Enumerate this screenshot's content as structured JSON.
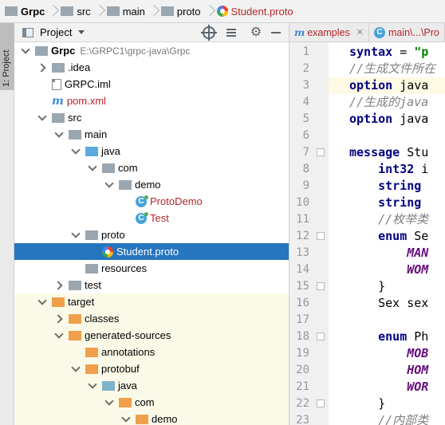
{
  "breadcrumb": [
    {
      "label": "Grpc",
      "icon": "folder",
      "color": "grey",
      "bold": true
    },
    {
      "label": "src",
      "icon": "folder",
      "color": "grey"
    },
    {
      "label": "main",
      "icon": "folder",
      "color": "grey"
    },
    {
      "label": "proto",
      "icon": "folder",
      "color": "grey"
    },
    {
      "label": "Student.proto",
      "icon": "proto",
      "red": true
    }
  ],
  "side_strip": {
    "label": "1: Project"
  },
  "project_panel": {
    "title": "Project"
  },
  "tree": [
    {
      "label": "Grpc",
      "path": "E:\\GRPC1\\grpc-java\\Grpc",
      "depth": 0,
      "arrow": "open",
      "icon": "folder-grey",
      "bold": true
    },
    {
      "label": ".idea",
      "depth": 1,
      "arrow": "closed",
      "icon": "folder-grey"
    },
    {
      "label": "GRPC.iml",
      "depth": 1,
      "arrow": "none",
      "icon": "iml"
    },
    {
      "label": "pom.xml",
      "depth": 1,
      "arrow": "none",
      "icon": "maven",
      "red": true
    },
    {
      "label": "src",
      "depth": 1,
      "arrow": "open",
      "icon": "folder-grey"
    },
    {
      "label": "main",
      "depth": 2,
      "arrow": "open",
      "icon": "folder-grey"
    },
    {
      "label": "java",
      "depth": 3,
      "arrow": "open",
      "icon": "folder-blue"
    },
    {
      "label": "com",
      "depth": 4,
      "arrow": "open",
      "icon": "folder-grey"
    },
    {
      "label": "demo",
      "depth": 5,
      "arrow": "open",
      "icon": "folder-grey"
    },
    {
      "label": "ProtoDemo",
      "depth": 6,
      "arrow": "none",
      "icon": "class",
      "red": true
    },
    {
      "label": "Test",
      "depth": 6,
      "arrow": "none",
      "icon": "class",
      "red": true
    },
    {
      "label": "proto",
      "depth": 3,
      "arrow": "open",
      "icon": "folder-grey"
    },
    {
      "label": "Student.proto",
      "depth": 4,
      "arrow": "none",
      "icon": "proto",
      "selected": true
    },
    {
      "label": "resources",
      "depth": 3,
      "arrow": "none",
      "icon": "folder-resources"
    },
    {
      "label": "test",
      "depth": 2,
      "arrow": "closed",
      "icon": "folder-grey"
    },
    {
      "label": "target",
      "depth": 1,
      "arrow": "open",
      "icon": "folder-orange",
      "highlight": true
    },
    {
      "label": "classes",
      "depth": 2,
      "arrow": "closed",
      "icon": "folder-orange",
      "highlight": true
    },
    {
      "label": "generated-sources",
      "depth": 2,
      "arrow": "open",
      "icon": "folder-orange",
      "highlight": true
    },
    {
      "label": "annotations",
      "depth": 3,
      "arrow": "none",
      "icon": "folder-orange",
      "highlight": true
    },
    {
      "label": "protobuf",
      "depth": 3,
      "arrow": "open",
      "icon": "folder-orange",
      "highlight": true
    },
    {
      "label": "java",
      "depth": 4,
      "arrow": "open",
      "icon": "folder-teal",
      "highlight": true
    },
    {
      "label": "com",
      "depth": 5,
      "arrow": "open",
      "icon": "folder-orange",
      "highlight": true
    },
    {
      "label": "demo",
      "depth": 6,
      "arrow": "open",
      "icon": "folder-orange",
      "highlight": true
    }
  ],
  "tabs": [
    {
      "label": "examples",
      "icon": "maven",
      "close": "✕"
    },
    {
      "label": "main\\...\\Pro",
      "icon": "class"
    }
  ],
  "editor": {
    "current_line": 3,
    "lines": [
      {
        "n": "1",
        "parts": [
          {
            "t": "syntax",
            "c": "kw"
          },
          {
            "t": " = ",
            "c": ""
          },
          {
            "t": "\"p",
            "c": "str"
          }
        ]
      },
      {
        "n": "2",
        "parts": [
          {
            "t": "//生成文件所在",
            "c": "cm"
          }
        ]
      },
      {
        "n": "3",
        "parts": [
          {
            "t": "option",
            "c": "kw"
          },
          {
            "t": " java",
            "c": ""
          }
        ]
      },
      {
        "n": "4",
        "parts": [
          {
            "t": "//生成的java",
            "c": "cm"
          }
        ]
      },
      {
        "n": "5",
        "parts": [
          {
            "t": "option",
            "c": "kw"
          },
          {
            "t": " java",
            "c": ""
          }
        ]
      },
      {
        "n": "6",
        "parts": []
      },
      {
        "n": "7",
        "parts": [
          {
            "t": "message",
            "c": "kw"
          },
          {
            "t": " Stu",
            "c": ""
          }
        ]
      },
      {
        "n": "8",
        "parts": [
          {
            "t": "    ",
            "c": ""
          },
          {
            "t": "int32",
            "c": "kw"
          },
          {
            "t": " i",
            "c": ""
          }
        ]
      },
      {
        "n": "9",
        "parts": [
          {
            "t": "    ",
            "c": ""
          },
          {
            "t": "string",
            "c": "kw"
          }
        ]
      },
      {
        "n": "10",
        "parts": [
          {
            "t": "    ",
            "c": ""
          },
          {
            "t": "string",
            "c": "kw"
          }
        ]
      },
      {
        "n": "11",
        "parts": [
          {
            "t": "    ",
            "c": ""
          },
          {
            "t": "//枚举类",
            "c": "cm"
          }
        ]
      },
      {
        "n": "12",
        "parts": [
          {
            "t": "    ",
            "c": ""
          },
          {
            "t": "enum",
            "c": "kw"
          },
          {
            "t": " Se",
            "c": ""
          }
        ]
      },
      {
        "n": "13",
        "parts": [
          {
            "t": "        ",
            "c": ""
          },
          {
            "t": "MAN",
            "c": "en"
          }
        ]
      },
      {
        "n": "14",
        "parts": [
          {
            "t": "        ",
            "c": ""
          },
          {
            "t": "WOM",
            "c": "en"
          }
        ]
      },
      {
        "n": "15",
        "parts": [
          {
            "t": "    }",
            "c": ""
          }
        ]
      },
      {
        "n": "16",
        "parts": [
          {
            "t": "    Sex sex",
            "c": ""
          }
        ]
      },
      {
        "n": "17",
        "parts": []
      },
      {
        "n": "18",
        "parts": [
          {
            "t": "    ",
            "c": ""
          },
          {
            "t": "enum",
            "c": "kw"
          },
          {
            "t": " Ph",
            "c": ""
          }
        ]
      },
      {
        "n": "19",
        "parts": [
          {
            "t": "        ",
            "c": ""
          },
          {
            "t": "MOB",
            "c": "en"
          }
        ]
      },
      {
        "n": "20",
        "parts": [
          {
            "t": "        ",
            "c": ""
          },
          {
            "t": "HOM",
            "c": "en"
          }
        ]
      },
      {
        "n": "21",
        "parts": [
          {
            "t": "        ",
            "c": ""
          },
          {
            "t": "WOR",
            "c": "en"
          }
        ]
      },
      {
        "n": "22",
        "parts": [
          {
            "t": "    }",
            "c": ""
          }
        ]
      },
      {
        "n": "23",
        "parts": [
          {
            "t": "    ",
            "c": ""
          },
          {
            "t": "//内部类",
            "c": "cm"
          }
        ]
      }
    ],
    "fold_markers": [
      "7",
      "12",
      "15",
      "18",
      "22"
    ]
  }
}
